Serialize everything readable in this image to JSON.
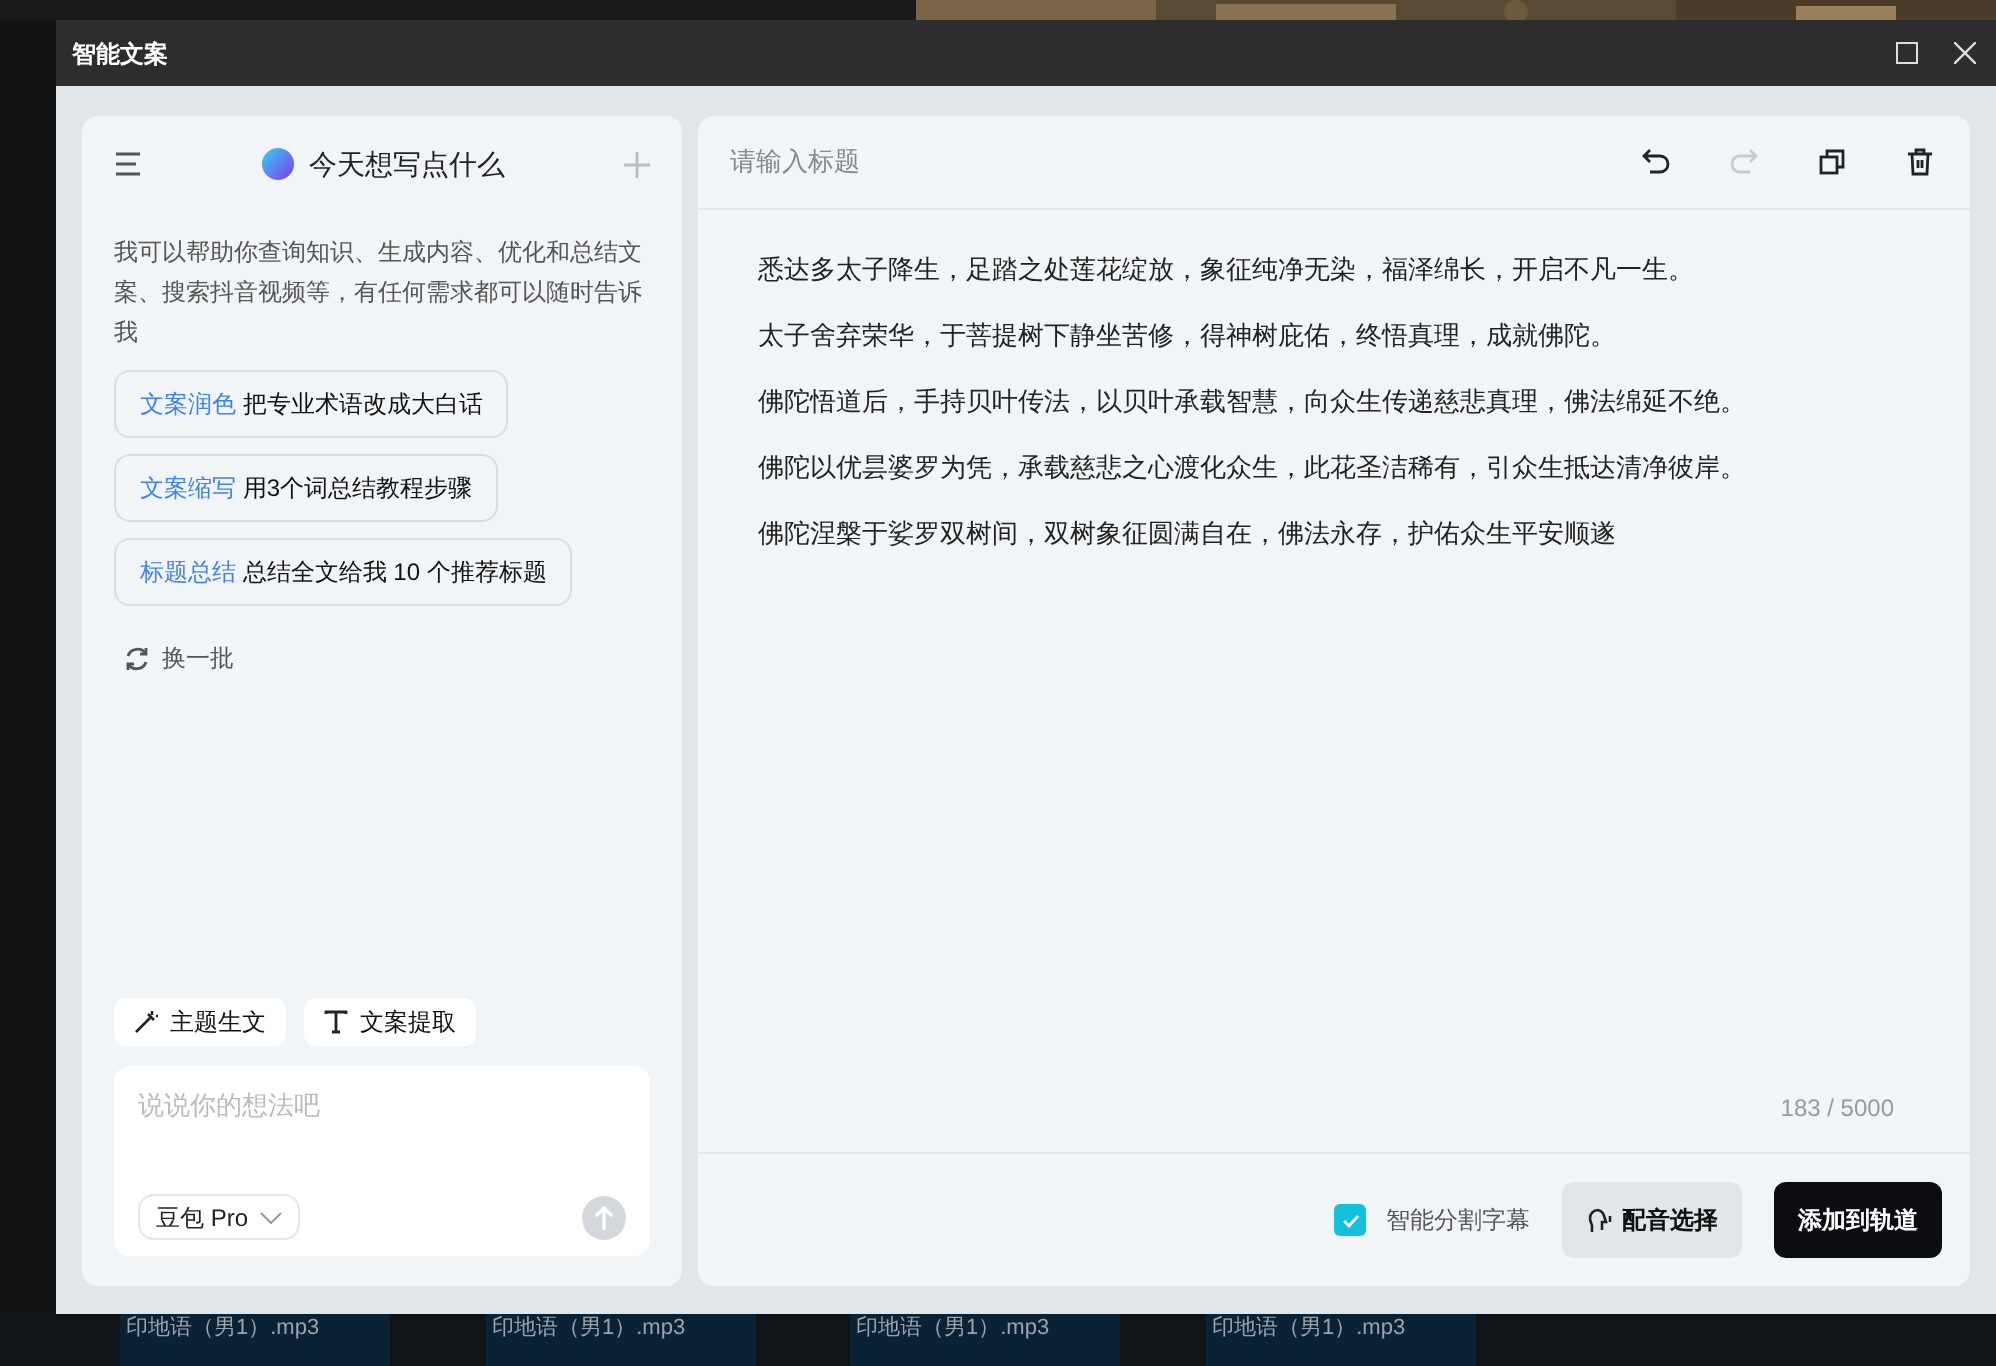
{
  "window": {
    "title": "智能文案"
  },
  "assistant": {
    "title": "今天想写点什么",
    "intro": "我可以帮助你查询知识、生成内容、优化和总结文案、搜索抖音视频等，有任何需求都可以随时告诉我",
    "suggestions": [
      {
        "tag": "文案润色",
        "text": "把专业术语改成大白话"
      },
      {
        "tag": "文案缩写",
        "text": "用3个词总结教程步骤"
      },
      {
        "tag": "标题总结",
        "text": "总结全文给我 10 个推荐标题"
      }
    ],
    "refresh": "换一批",
    "tools": [
      {
        "kind": "wand",
        "label": "主题生文"
      },
      {
        "kind": "text",
        "label": "文案提取"
      }
    ],
    "input": {
      "placeholder": "说说你的想法吧"
    },
    "model": "豆包 Pro"
  },
  "editor": {
    "title": {
      "placeholder": "请输入标题"
    },
    "toolbar": [
      {
        "kind": "undo",
        "disabled": false
      },
      {
        "kind": "redo",
        "disabled": true
      },
      {
        "kind": "copy",
        "disabled": false
      },
      {
        "kind": "delete",
        "disabled": false
      }
    ],
    "paragraphs": [
      "悉达多太子降生，足踏之处莲花绽放，象征纯净无染，福泽绵长，开启不凡一生。",
      "太子舍弃荣华，于菩提树下静坐苦修，得神树庇佑，终悟真理，成就佛陀。",
      "佛陀悟道后，手持贝叶传法，以贝叶承载智慧，向众生传递慈悲真理，佛法绵延不绝。",
      "佛陀以优昙婆罗为凭，承载慈悲之心渡化众生，此花圣洁稀有，引众生抵达清净彼岸。",
      "佛陀涅槃于娑罗双树间，双树象征圆满自在，佛法永存，护佑众生平安顺遂"
    ],
    "count": "183 / 5000",
    "smart_split": {
      "label": "智能分割字幕",
      "checked": true
    },
    "voice_button": "配音选择",
    "add_button": "添加到轨道"
  },
  "timeline": {
    "clips": [
      "印地语（男1）.mp3",
      "印地语（男1）.mp3",
      "印地语（男1）.mp3",
      "印地语（男1）.mp3"
    ]
  }
}
